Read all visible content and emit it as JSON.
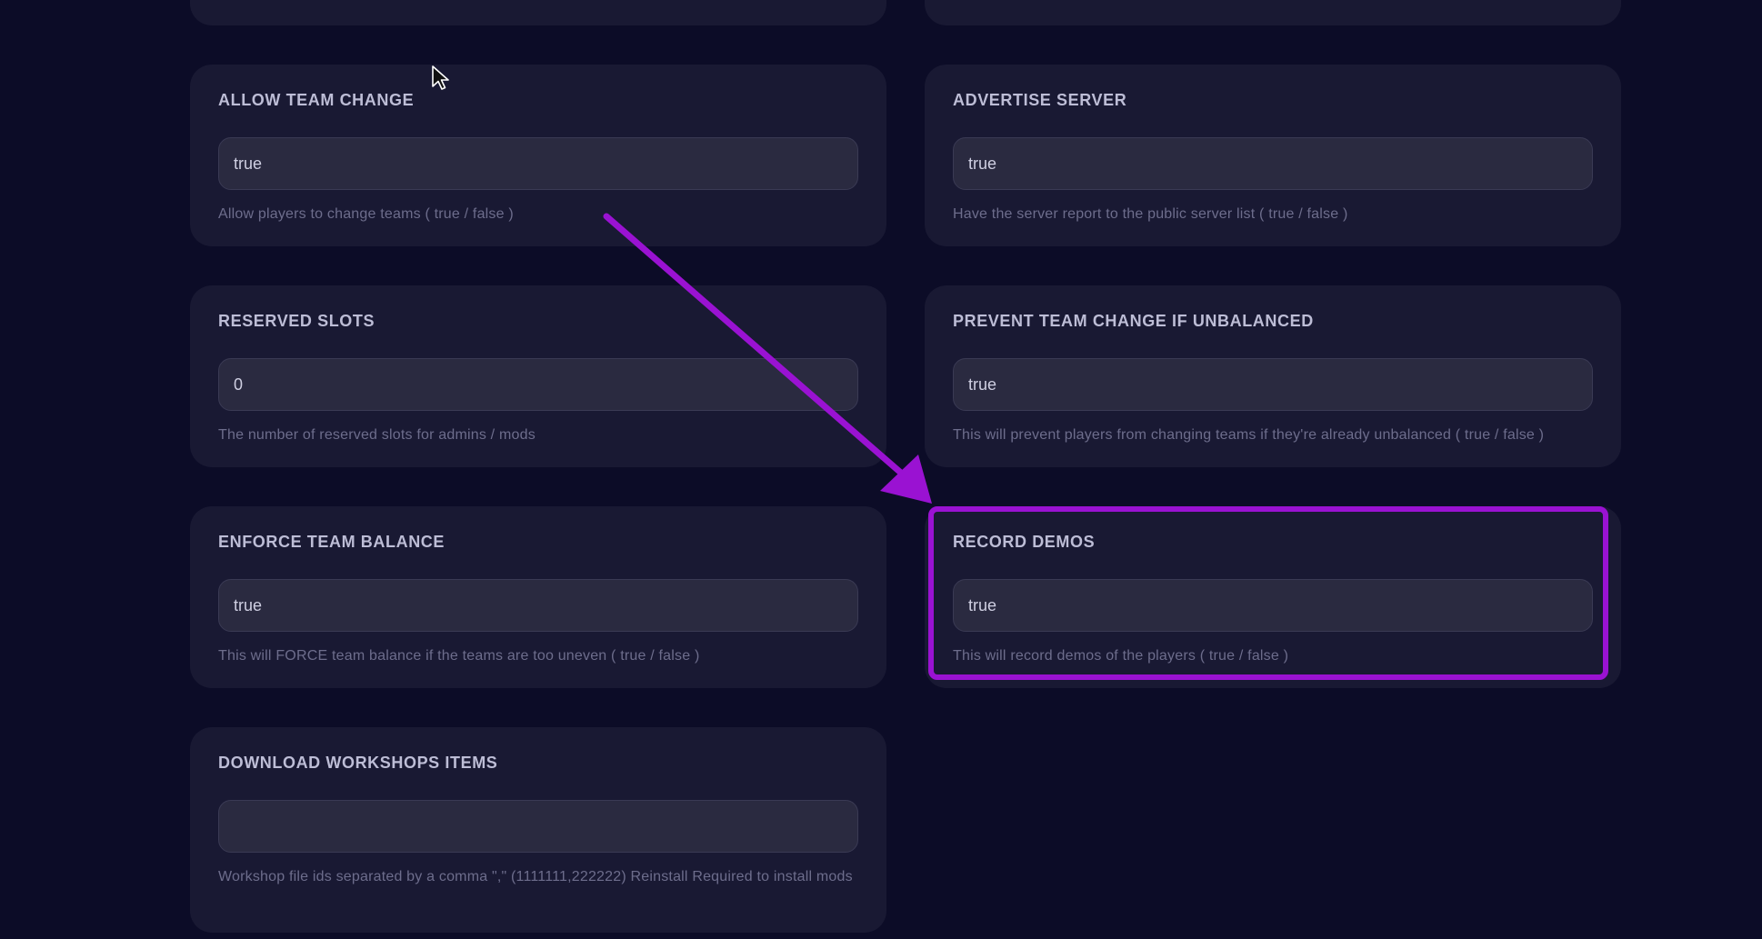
{
  "settings": {
    "allow_team_change": {
      "label": "ALLOW TEAM CHANGE",
      "value": "true",
      "help": "Allow players to change teams ( true / false )"
    },
    "advertise_server": {
      "label": "ADVERTISE SERVER",
      "value": "true",
      "help": "Have the server report to the public server list ( true / false )"
    },
    "reserved_slots": {
      "label": "RESERVED SLOTS",
      "value": "0",
      "help": "The number of reserved slots for admins / mods"
    },
    "prevent_team_change": {
      "label": "PREVENT TEAM CHANGE IF UNBALANCED",
      "value": "true",
      "help": "This will prevent players from changing teams if they're already unbalanced ( true / false )"
    },
    "enforce_team_balance": {
      "label": "ENFORCE TEAM BALANCE",
      "value": "true",
      "help": "This will FORCE team balance if the teams are too uneven ( true / false )"
    },
    "record_demos": {
      "label": "RECORD DEMOS",
      "value": "true",
      "help": "This will record demos of the players ( true / false )"
    },
    "download_workshop_items": {
      "label": "DOWNLOAD WORKSHOPS ITEMS",
      "value": "",
      "help": "Workshop file ids separated by a comma \",\" (1111111,222222) Reinstall Required to install mods"
    }
  },
  "annotation": {
    "color": "#9a12d2"
  }
}
